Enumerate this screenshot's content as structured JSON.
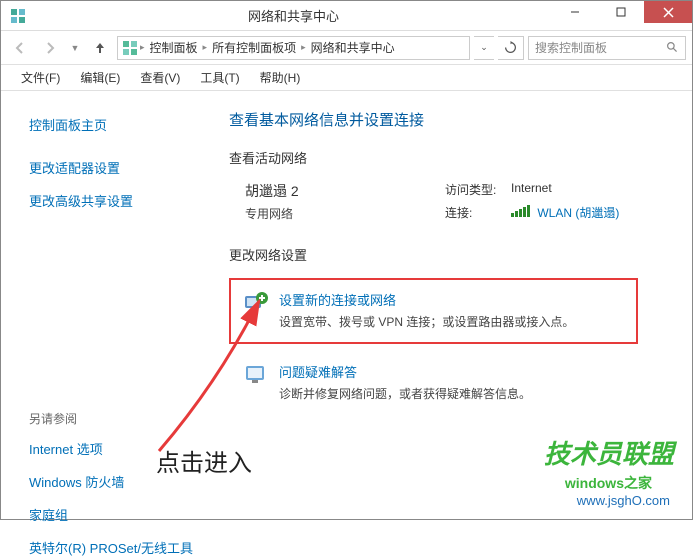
{
  "window": {
    "title": "网络和共享中心"
  },
  "addressbar": {
    "segments": [
      "控制面板",
      "所有控制面板项",
      "网络和共享中心"
    ],
    "search_placeholder": "搜索控制面板"
  },
  "menubar": [
    "文件(F)",
    "编辑(E)",
    "查看(V)",
    "工具(T)",
    "帮助(H)"
  ],
  "sidebar": {
    "home": "控制面板主页",
    "links": [
      "更改适配器设置",
      "更改高级共享设置"
    ],
    "see_also_heading": "另请参阅",
    "see_also": [
      "Internet 选项",
      "Windows 防火墙",
      "家庭组",
      "英特尔(R) PROSet/无线工具"
    ]
  },
  "main": {
    "heading": "查看基本网络信息并设置连接",
    "view_active": "查看活动网络",
    "network": {
      "name": "胡邋遢 2",
      "type": "专用网络",
      "access_label": "访问类型:",
      "access_value": "Internet",
      "conn_label": "连接:",
      "conn_value": "WLAN (胡邋遢)"
    },
    "change_heading": "更改网络设置",
    "options": [
      {
        "title": "设置新的连接或网络",
        "desc": "设置宽带、拨号或 VPN 连接；或设置路由器或接入点。"
      },
      {
        "title": "问题疑难解答",
        "desc": "诊断并修复网络问题，或者获得疑难解答信息。"
      }
    ]
  },
  "annotation": "点击进入",
  "watermarks": {
    "brand": "技术员联盟",
    "sub": "windows之家",
    "url": "www.jsghO.com"
  }
}
